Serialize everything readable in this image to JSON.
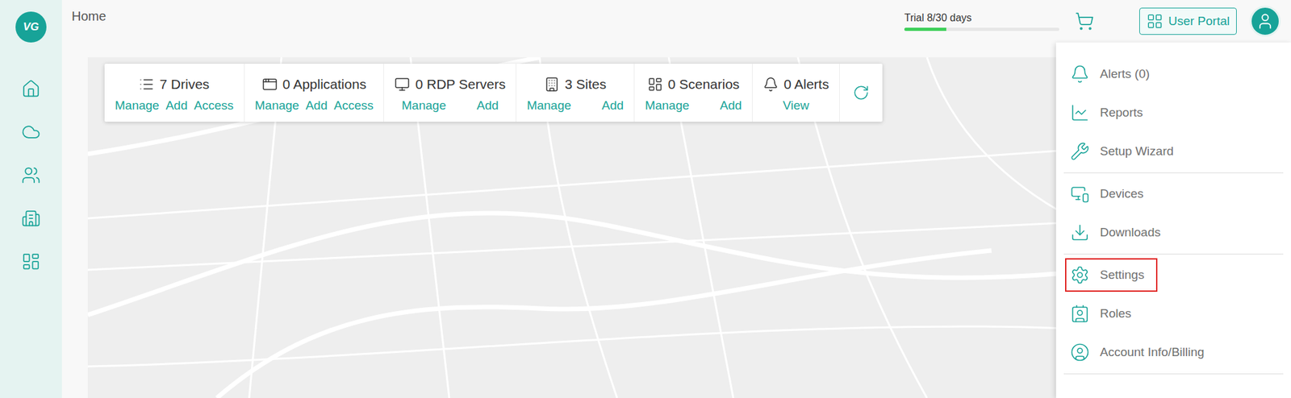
{
  "logo": "VG",
  "topbar": {
    "title": "Home",
    "trial": {
      "label": "Trial 8/30 days",
      "level": 0.27
    },
    "portal_button": "User Portal"
  },
  "stats": [
    {
      "label": "7 Drives",
      "actions": [
        "Manage",
        "Add",
        "Access"
      ]
    },
    {
      "label": "0 Applications",
      "actions": [
        "Manage",
        "Add",
        "Access"
      ]
    },
    {
      "label": "0 RDP Servers",
      "actions": [
        "Manage",
        "Add"
      ]
    },
    {
      "label": "3 Sites",
      "actions": [
        "Manage",
        "Add"
      ]
    },
    {
      "label": "0 Scenarios",
      "actions": [
        "Manage",
        "Add"
      ]
    },
    {
      "label": "0 Alerts",
      "actions": [
        "View"
      ]
    }
  ],
  "menu": {
    "groups": [
      [
        {
          "label": "Alerts (0)",
          "highlighted": false
        },
        {
          "label": "Reports",
          "highlighted": false
        },
        {
          "label": "Setup Wizard",
          "highlighted": false
        }
      ],
      [
        {
          "label": "Devices",
          "highlighted": false
        },
        {
          "label": "Downloads",
          "highlighted": false
        }
      ],
      [
        {
          "label": "Settings",
          "highlighted": true
        },
        {
          "label": "Roles",
          "highlighted": false
        },
        {
          "label": "Account Info/Billing",
          "highlighted": false
        }
      ]
    ]
  }
}
